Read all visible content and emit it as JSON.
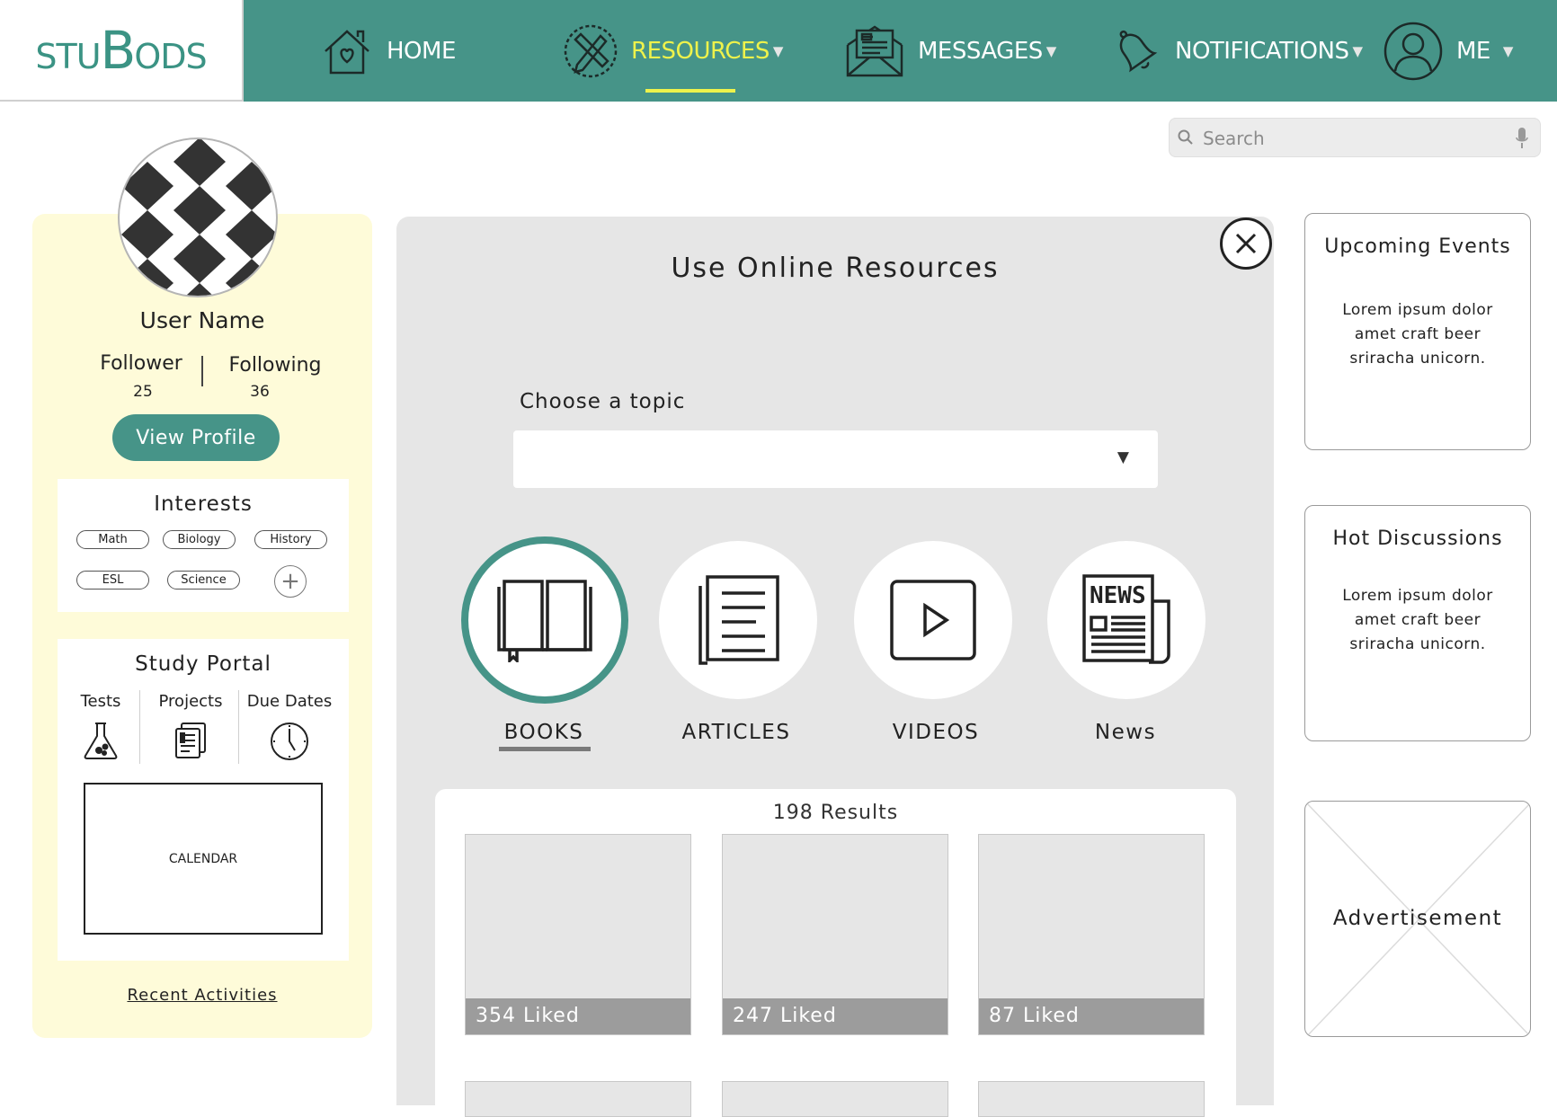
{
  "brand": {
    "logo_text": "STUBODS"
  },
  "nav": {
    "items": [
      {
        "label": "HOME",
        "icon": "house-heart-icon",
        "dropdown": false,
        "active": false
      },
      {
        "label": "RESOURCES",
        "icon": "pencil-ruler-icon",
        "dropdown": true,
        "active": true
      },
      {
        "label": "MESSAGES",
        "icon": "envelope-letter-icon",
        "dropdown": true,
        "active": false
      },
      {
        "label": "NOTIFICATIONS",
        "icon": "bell-icon",
        "dropdown": true,
        "active": false
      },
      {
        "label": "ME",
        "icon": "user-avatar-icon",
        "dropdown": true,
        "active": false
      }
    ],
    "caret": "▼"
  },
  "search": {
    "placeholder": "Search",
    "value": ""
  },
  "profile": {
    "user_name": "User Name",
    "follower_label": "Follower",
    "follower_count": "25",
    "following_label": "Following",
    "following_count": "36",
    "view_profile_label": "View Profile"
  },
  "interests": {
    "title": "Interests",
    "tags": [
      "Math",
      "Biology",
      "History",
      "ESL",
      "Science"
    ],
    "add_symbol": "+"
  },
  "study_portal": {
    "title": "Study Portal",
    "columns": [
      {
        "label": "Tests",
        "icon": "flask-icon"
      },
      {
        "label": "Projects",
        "icon": "documents-icon"
      },
      {
        "label": "Due Dates",
        "icon": "clock-icon"
      }
    ],
    "calendar_label": "CALENDAR"
  },
  "recent_activities_label": "Recent Activities",
  "modal": {
    "title": "Use Online Resources",
    "choose_label": "Choose a topic",
    "topic_value": "",
    "select_arrow": "▼",
    "resources": [
      {
        "label": "BOOKS",
        "icon": "book-icon",
        "selected": true
      },
      {
        "label": "ARTICLES",
        "icon": "article-icon",
        "selected": false
      },
      {
        "label": "VIDEOS",
        "icon": "play-video-icon",
        "selected": false
      },
      {
        "label": "News",
        "icon": "newspaper-icon",
        "selected": false
      }
    ],
    "results_count": "198 Results",
    "results": [
      {
        "likes": "354 Liked"
      },
      {
        "likes": "247 Liked"
      },
      {
        "likes": "87 Liked"
      }
    ]
  },
  "sidebar_right": {
    "upcoming_events": {
      "title": "Upcoming Events",
      "body": "Lorem ipsum dolor amet craft beer sriracha unicorn."
    },
    "hot_discussions": {
      "title": "Hot Discussions",
      "body": "Lorem ipsum dolor amet craft beer sriracha unicorn."
    },
    "advertisement_label": "Advertisement"
  },
  "colors": {
    "teal": "#469488",
    "active_yellow": "#eef24b",
    "profile_panel": "#fefbd9",
    "modal_bg": "#e6e6e6"
  }
}
